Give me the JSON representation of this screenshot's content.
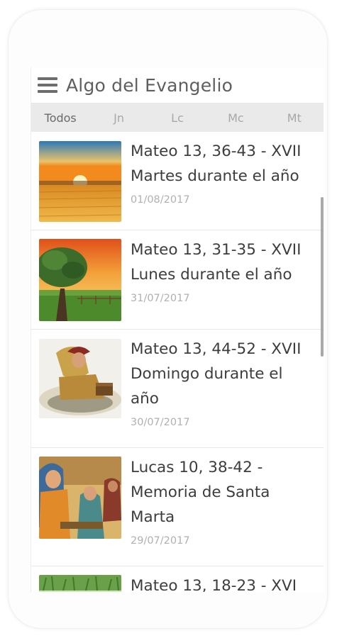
{
  "app": {
    "title": "Algo del Evangelio"
  },
  "tabs": [
    {
      "label": "Todos",
      "active": true
    },
    {
      "label": "Jn"
    },
    {
      "label": "Lc"
    },
    {
      "label": "Mc"
    },
    {
      "label": "Mt"
    }
  ],
  "items": [
    {
      "title": "Mateo 13, 36-43 - XVII\nMartes durante el año",
      "date": "01/08/2017",
      "thumbnail": "sunset-wheat-field"
    },
    {
      "title": "Mateo 13, 31-35 - XVII\nLunes durante el año",
      "date": "31/07/2017",
      "thumbnail": "mustard-tree"
    },
    {
      "title": "Mateo 13, 44-52 - XVII\nDomingo durante el\naño",
      "date": "30/07/2017",
      "thumbnail": "man-digging-treasure"
    },
    {
      "title": "Lucas 10, 38-42 -\nMemoria de Santa\nMarta",
      "date": "29/07/2017",
      "thumbnail": "martha-and-mary"
    },
    {
      "title": "Mateo 13, 18-23 - XVI",
      "date": "",
      "thumbnail": "green-field"
    }
  ],
  "colors": {
    "appbar_bg": "#ffffff",
    "tabs_bg": "#eaeaea",
    "title_text": "#3d3d3d",
    "date_text": "#b0b0b0"
  }
}
